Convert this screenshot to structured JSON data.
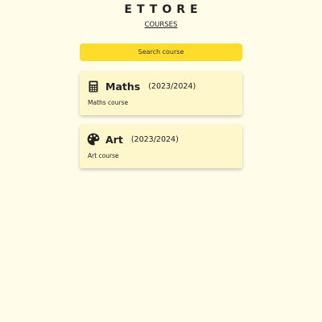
{
  "header": {
    "brand": "ETTORE",
    "nav_link": "COURSES"
  },
  "search": {
    "button_label": "Search course"
  },
  "courses": [
    {
      "icon": "calculator-icon",
      "title": "Maths",
      "year": "(2023/2024)",
      "description": "Maths course"
    },
    {
      "icon": "palette-icon",
      "title": "Art",
      "year": "(2023/2024)",
      "description": "Art course"
    }
  ],
  "colors": {
    "background": "#fffdea",
    "accent": "#fedc2b",
    "card": "#fef7cc",
    "text": "#222222"
  }
}
